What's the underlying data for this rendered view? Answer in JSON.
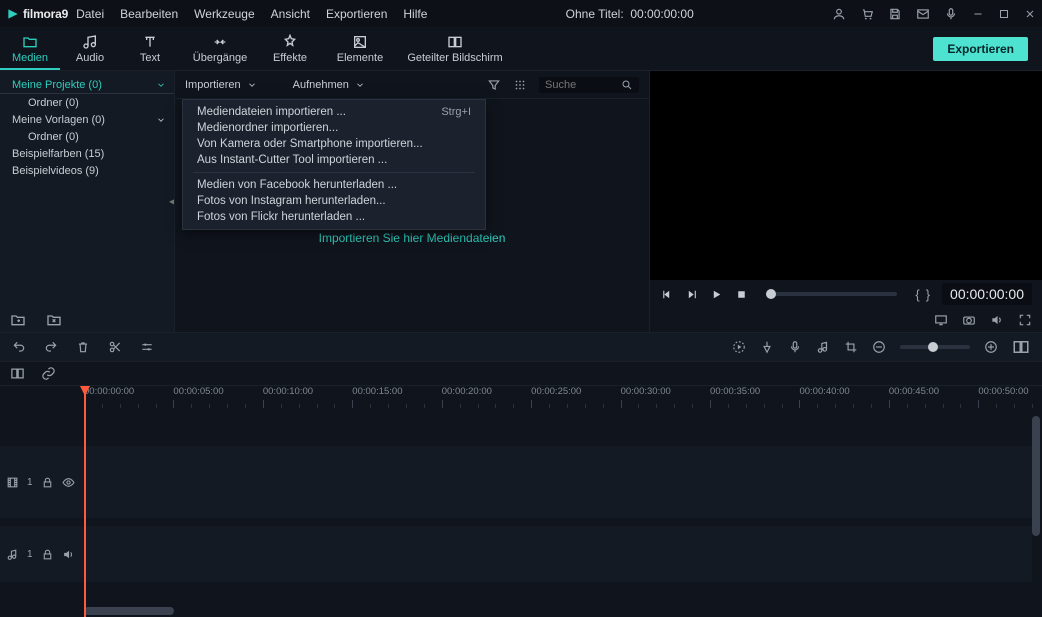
{
  "app": {
    "name": "filmora",
    "version": "9",
    "title_prefix": "Ohne Titel:",
    "title_time": "00:00:00:00"
  },
  "menu": [
    "Datei",
    "Bearbeiten",
    "Werkzeuge",
    "Ansicht",
    "Exportieren",
    "Hilfe"
  ],
  "tool_tabs": [
    {
      "id": "media",
      "label": "Medien",
      "icon": "folder-icon",
      "active": true
    },
    {
      "id": "audio",
      "label": "Audio",
      "icon": "music-icon"
    },
    {
      "id": "text",
      "label": "Text",
      "icon": "text-icon"
    },
    {
      "id": "transitions",
      "label": "Übergänge",
      "icon": "transitions-icon"
    },
    {
      "id": "effects",
      "label": "Effekte",
      "icon": "effects-icon"
    },
    {
      "id": "elements",
      "label": "Elemente",
      "icon": "elements-icon"
    },
    {
      "id": "splitscreen",
      "label": "Geteilter Bildschirm",
      "icon": "splitscreen-icon"
    }
  ],
  "export_label": "Exportieren",
  "sidebar": {
    "items": [
      {
        "label": "Meine Projekte (0)",
        "indent": false,
        "active": true,
        "chev": true
      },
      {
        "label": "Ordner (0)",
        "indent": true
      },
      {
        "label": "Meine Vorlagen (0)",
        "indent": false,
        "chev": true
      },
      {
        "label": "Ordner (0)",
        "indent": true
      },
      {
        "label": "Beispielfarben (15)",
        "indent": false
      },
      {
        "label": "Beispielvideos (9)",
        "indent": false
      }
    ]
  },
  "media_toolbar": {
    "import": "Importieren",
    "record": "Aufnehmen",
    "search_placeholder": "Suche"
  },
  "import_menu": [
    {
      "label": "Mediendateien importieren ...",
      "shortcut": "Strg+I"
    },
    {
      "label": "Medienordner importieren..."
    },
    {
      "label": "Von Kamera oder Smartphone importieren..."
    },
    {
      "label": "Aus Instant-Cutter Tool importieren ..."
    },
    {
      "sep": true
    },
    {
      "label": "Medien von Facebook herunterladen ..."
    },
    {
      "label": "Fotos von Instagram herunterladen..."
    },
    {
      "label": "Fotos von Flickr herunterladen ..."
    }
  ],
  "dropzone_text": "Importieren Sie hier Mediendateien",
  "preview": {
    "timecode": "00:00:00:00"
  },
  "timeline": {
    "marks": [
      "00:00:00:00",
      "00:00:05:00",
      "00:00:10:00",
      "00:00:15:00",
      "00:00:20:00",
      "00:00:25:00",
      "00:00:30:00",
      "00:00:35:00",
      "00:00:40:00",
      "00:00:45:00",
      "00:00:50:00"
    ],
    "video_track_num": "1",
    "audio_track_num": "1"
  }
}
